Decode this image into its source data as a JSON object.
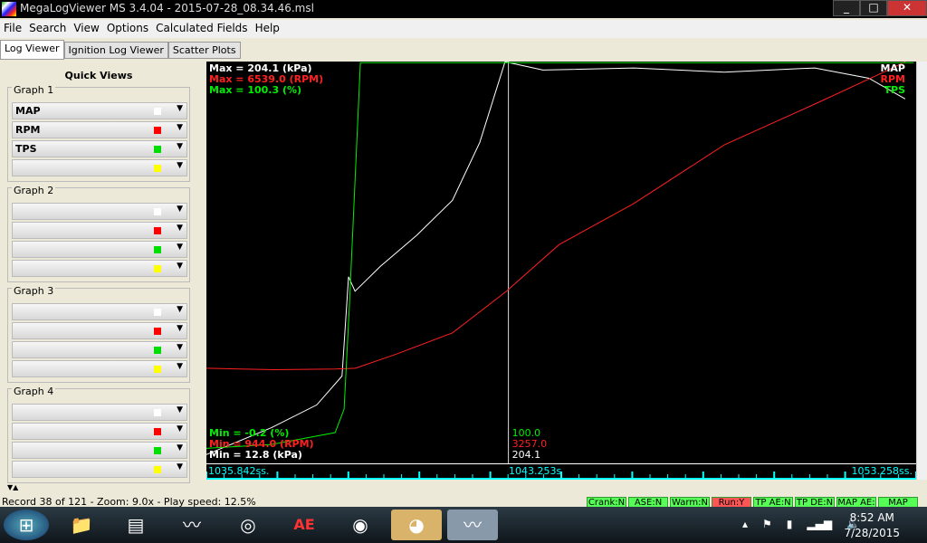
{
  "window": {
    "title": "MegaLogViewer MS 3.4.04 - 2015-07-28_08.34.46.msl",
    "min": "_",
    "max": "□",
    "close": "✕"
  },
  "menu": [
    "File",
    "Search",
    "View",
    "Options",
    "Calculated Fields",
    "Help"
  ],
  "tabs": [
    "Log Viewer",
    "Ignition Log Viewer",
    "Scatter Plots"
  ],
  "quick_views": {
    "title": "Quick Views",
    "groups": [
      {
        "label": "Graph 1",
        "fields": [
          "MAP",
          "RPM",
          "TPS",
          ""
        ]
      },
      {
        "label": "Graph 2",
        "fields": [
          "",
          "",
          "",
          ""
        ]
      },
      {
        "label": "Graph 3",
        "fields": [
          "",
          "",
          "",
          ""
        ]
      },
      {
        "label": "Graph 4",
        "fields": [
          "",
          "",
          "",
          ""
        ]
      }
    ],
    "colors": [
      "#ffffff",
      "#ff0000",
      "#00dd00",
      "#ffff00"
    ]
  },
  "chart_data": {
    "type": "line",
    "x_range": [
      1035.842,
      1053.258
    ],
    "cursor_time": 1043.253,
    "series": [
      {
        "name": "MAP",
        "color": "#ffffff",
        "max_label": "Max = 204.1 (kPa)",
        "min_label": "Min = 12.8 (kPa)",
        "range": [
          12.8,
          204.1
        ],
        "cursor_value": "204.1",
        "points": [
          [
            1035.84,
            14
          ],
          [
            1037.44,
            27
          ],
          [
            1038.55,
            38
          ],
          [
            1039.17,
            52
          ],
          [
            1039.33,
            100
          ],
          [
            1039.49,
            93
          ],
          [
            1040.11,
            105
          ],
          [
            1041.0,
            120
          ],
          [
            1041.88,
            137
          ],
          [
            1042.55,
            165
          ],
          [
            1043.17,
            204
          ],
          [
            1044.1,
            200
          ],
          [
            1046.33,
            201
          ],
          [
            1048.55,
            199
          ],
          [
            1050.77,
            201
          ],
          [
            1052.1,
            196
          ],
          [
            1052.99,
            186
          ]
        ]
      },
      {
        "name": "RPM",
        "color": "#ff2020",
        "max_label": "Max = 6539.0 (RPM)",
        "min_label": "Min = 944.0 (RPM)",
        "range": [
          944,
          6539
        ],
        "cursor_value": "3257.0",
        "points": [
          [
            1035.84,
            2200
          ],
          [
            1037.5,
            2180
          ],
          [
            1039.0,
            2190
          ],
          [
            1039.5,
            2200
          ],
          [
            1040.5,
            2400
          ],
          [
            1041.88,
            2700
          ],
          [
            1043.2,
            3287
          ],
          [
            1044.5,
            3950
          ],
          [
            1046.33,
            4530
          ],
          [
            1048.55,
            5360
          ],
          [
            1050.77,
            5937
          ],
          [
            1052.5,
            6400
          ],
          [
            1053.0,
            6539
          ]
        ]
      },
      {
        "name": "TPS",
        "color": "#00ee00",
        "max_label": "Max = 100.3 (%)",
        "min_label": "Min = -0.2 (%)",
        "range": [
          -0.2,
          100.3
        ],
        "cursor_value": "100.0",
        "points": [
          [
            1035.84,
            2
          ],
          [
            1037.44,
            3
          ],
          [
            1039.0,
            6
          ],
          [
            1039.22,
            12
          ],
          [
            1039.35,
            38
          ],
          [
            1039.62,
            100
          ],
          [
            1044,
            100
          ],
          [
            1053.2,
            100
          ]
        ]
      }
    ],
    "axis_labels": {
      "start": "1035.842ss.",
      "cursor": "1043.253s",
      "end": "1053.258ss."
    }
  },
  "status": {
    "record": "Record 38 of 121 - Zoom: 9.0x - Play speed: 12.5%",
    "indicators": [
      {
        "label": "Crank:N",
        "on": false
      },
      {
        "label": "ASE:N",
        "on": false
      },
      {
        "label": "Warm:N",
        "on": false
      },
      {
        "label": "Run:Y",
        "on": true
      },
      {
        "label": "TP AE:N",
        "on": false
      },
      {
        "label": "TP DE:N",
        "on": false
      },
      {
        "label": "MAP AE:",
        "on": false
      },
      {
        "label": "MAP DE:",
        "on": false
      }
    ]
  },
  "taskbar": {
    "time": "8:52 AM",
    "date": "7/28/2015"
  }
}
